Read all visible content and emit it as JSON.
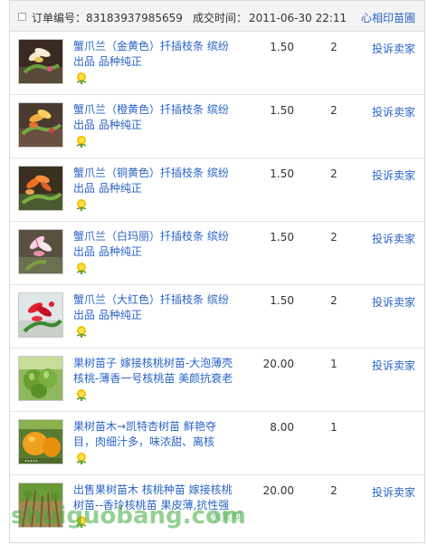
{
  "header": {
    "order_label": "订单编号：",
    "order_number": "83183937985659",
    "time_label": "成交时间：",
    "time_value": "2011-06-30 22:11",
    "shop_name": "心相印苗圃"
  },
  "items": [
    {
      "title": "蟹爪兰（金黄色）扦插枝条 缤纷出品 品种纯正",
      "price": "1.50",
      "qty": "2",
      "action": "投诉卖家",
      "image": "cactus-flower-gold"
    },
    {
      "title": "蟹爪兰（橙黄色）扦插枝条 缤纷出品 品种纯正",
      "price": "1.50",
      "qty": "2",
      "action": "投诉卖家",
      "image": "cactus-flower-orange-yellow"
    },
    {
      "title": "蟹爪兰（铜黄色）扦插枝条 缤纷出品 品种纯正",
      "price": "1.50",
      "qty": "2",
      "action": "投诉卖家",
      "image": "cactus-flower-copper"
    },
    {
      "title": "蟹爪兰（白玛丽）扦插枝条 缤纷出品 品种纯正",
      "price": "1.50",
      "qty": "2",
      "action": "投诉卖家",
      "image": "cactus-flower-white"
    },
    {
      "title": "蟹爪兰（大红色）扦插枝条 缤纷出品 品种纯正",
      "price": "1.50",
      "qty": "2",
      "action": "投诉卖家",
      "image": "cactus-flower-red"
    },
    {
      "title": "果树苗子 嫁接核桃树苗-大泡薄壳核桃-薄香一号核桃苗 美颜抗衰老",
      "price": "20.00",
      "qty": "1",
      "action": "投诉卖家",
      "image": "walnut-fruit"
    },
    {
      "title": "果树苗木→凯特杏树苗 鲜艳夺目，肉细汁多，味浓甜、离核",
      "price": "8.00",
      "qty": "1",
      "action": "",
      "image": "apricot-fruit"
    },
    {
      "title": "出售果树苗木 核桃种苗 嫁接核桃树苗--香玲核桃苗 果皮薄,抗性强",
      "price": "20.00",
      "qty": "2",
      "action": "投诉卖家",
      "image": "walnut-seedlings"
    }
  ],
  "watermark": {
    "text": "shuiguobang.com",
    "cn": "水果帮"
  },
  "colors": {
    "link": "#2a64c5",
    "header_bg": "#f3f3f3",
    "border": "#d9d9d9"
  }
}
